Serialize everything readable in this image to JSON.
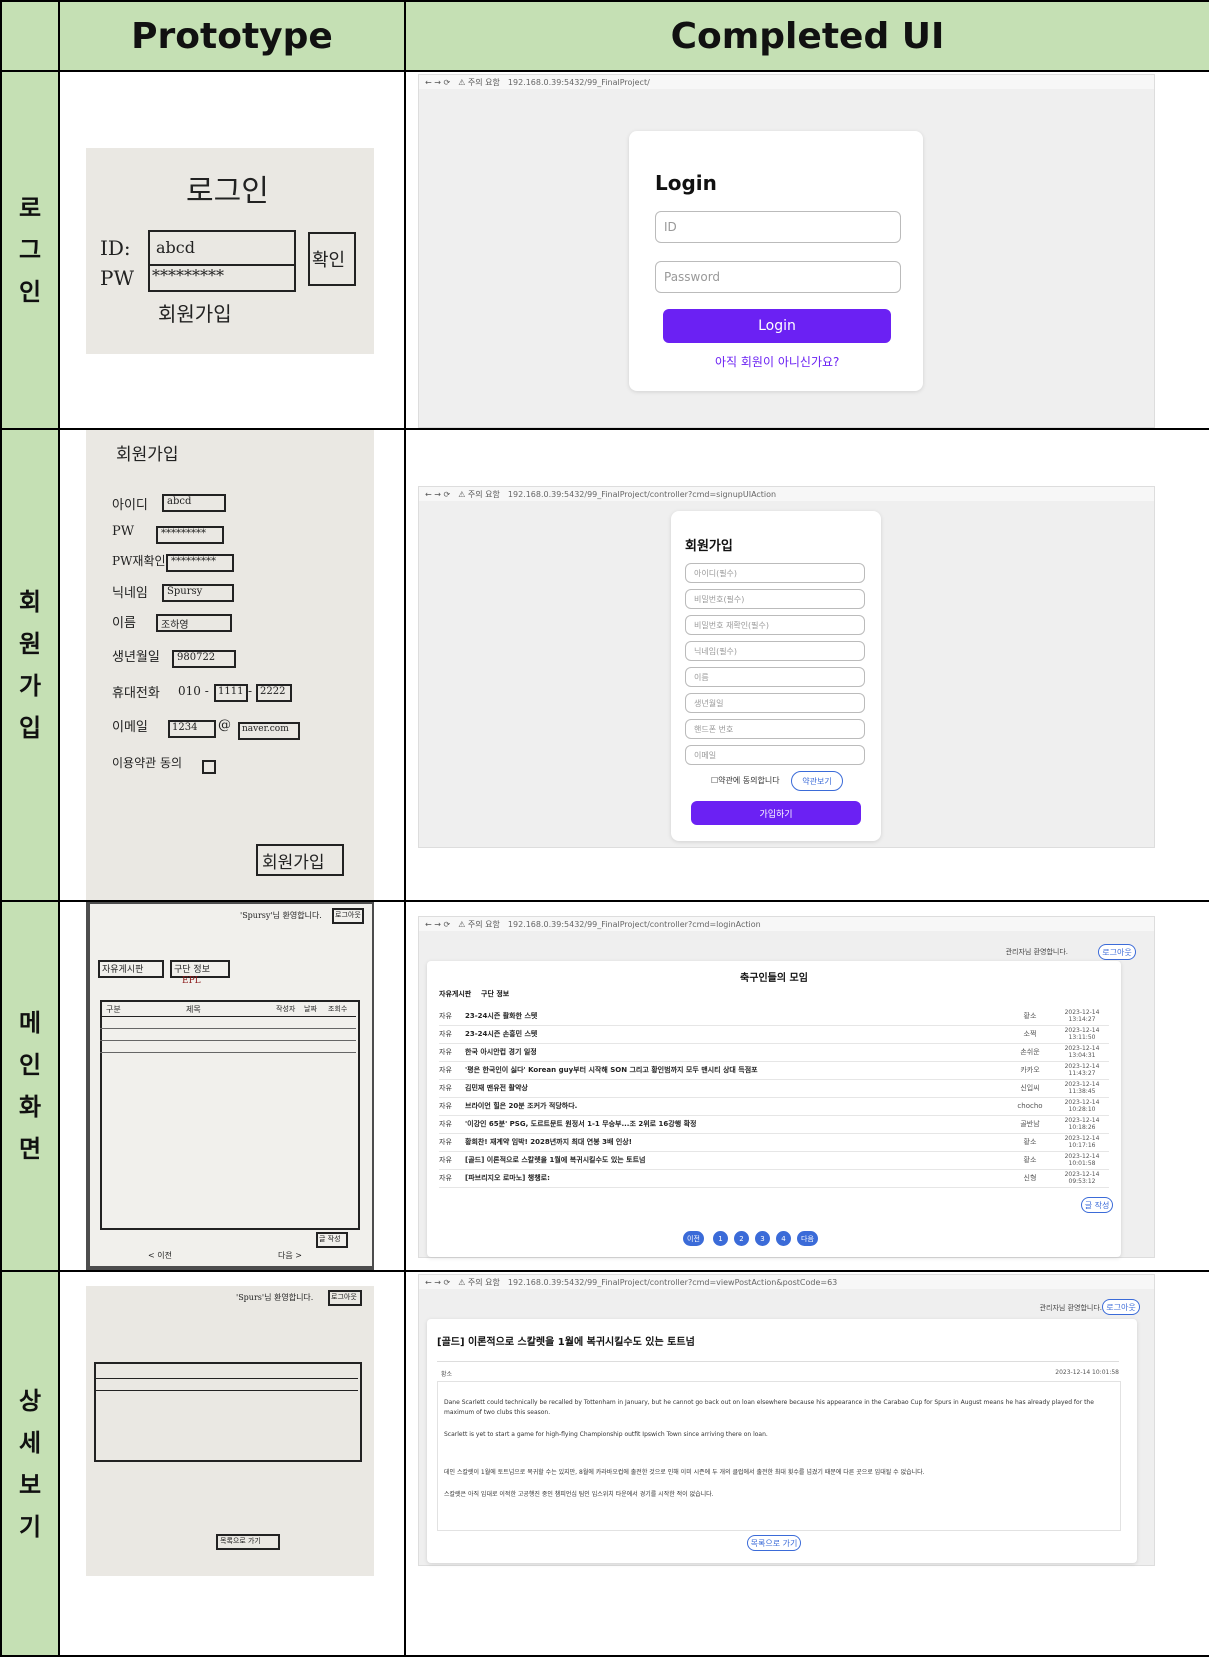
{
  "headers": {
    "prototype": "Prototype",
    "completed": "Completed UI"
  },
  "rows": {
    "login": {
      "label": [
        "로",
        "그",
        "인"
      ]
    },
    "signup": {
      "label": [
        "회",
        "원",
        "가",
        "입"
      ]
    },
    "main": {
      "label": [
        "메",
        "인",
        "화",
        "면"
      ]
    },
    "detail": {
      "label": [
        "상",
        "세",
        "보",
        "기"
      ]
    }
  },
  "proto_login": {
    "title": "로그인",
    "id_label": "ID:",
    "id_value": "abcd",
    "pw_label": "PW",
    "pw_value": "*********",
    "confirm": "확인",
    "signup": "회원가입"
  },
  "proto_signup": {
    "title": "회원가입",
    "fields": [
      {
        "label": "아이디",
        "value": "abcd"
      },
      {
        "label": "PW",
        "value": "*********"
      },
      {
        "label": "PW재확인",
        "value": "*********"
      },
      {
        "label": "닉네임",
        "value": "Spursy"
      },
      {
        "label": "이름",
        "value": "조하영"
      },
      {
        "label": "생년월일",
        "value": "980722"
      }
    ],
    "phone_label": "휴대전화",
    "phone_prefix": "010 -",
    "phone_mid": "1111",
    "phone_dash": "-",
    "phone_last": "2222",
    "email_label": "이메일",
    "email_user": "1234",
    "email_at": "@",
    "email_domain": "naver.com",
    "terms": "이용약관 동의",
    "submit": "회원가입"
  },
  "proto_main": {
    "greeting": "'Spursy'님 환영합니다.",
    "logout": "로그아웃",
    "tab_free": "자유게시판",
    "tab_club": "구단 정보",
    "tab_sub": "EPL",
    "col_type": "구분",
    "col_title": "제목",
    "col_author": "작성자",
    "col_date": "날짜",
    "col_views": "조회수",
    "write": "글 작성",
    "pager_prev": "< 이전",
    "pager_next": "다음 >"
  },
  "proto_detail": {
    "greeting": "'Spurs'님 환영합니다.",
    "logout": "로그아웃",
    "list_btn": "목록으로 가기"
  },
  "login_ui": {
    "title": "Login",
    "id_placeholder": "ID",
    "pw_placeholder": "Password",
    "button": "Login",
    "signup_link": "아직 회원이 아니신가요?"
  },
  "signup_ui": {
    "title": "회원가입",
    "fields": [
      "아이디(필수)",
      "비밀번호(필수)",
      "비밀번호 재확인(필수)",
      "닉네임(필수)",
      "이름",
      "생년월일",
      "핸드폰 번호",
      "이메일"
    ],
    "terms": "☐약관에 동의합니다",
    "terms_button": "약관보기",
    "submit": "가입하기"
  },
  "main_ui": {
    "greeting": "관리자님 환영합니다.",
    "logout": "로그아웃",
    "title": "축구인들의 모임",
    "tabs": [
      "자유게시판",
      "구단 정보"
    ],
    "posts": [
      {
        "type": "자유",
        "title": "23-24시즌 활화한 스텟",
        "author": "황소",
        "date": "2023-12-14",
        "time": "13:14:27"
      },
      {
        "type": "자유",
        "title": "23-24시즌 손흥민 스텟",
        "author": "소쩍",
        "date": "2023-12-14",
        "time": "13:11:50"
      },
      {
        "type": "자유",
        "title": "한국 아시안컵 경기 일정",
        "author": "손쉬운",
        "date": "2023-12-14",
        "time": "13:04:31"
      },
      {
        "type": "자유",
        "title": "'평은 한국인이 싫다' Korean guy부터 시작해 SON 그리고 황인범까지 모두 맨시티 상대 득점포",
        "author": "카카오",
        "date": "2023-12-14",
        "time": "11:43:27"
      },
      {
        "type": "자유",
        "title": "김민재 맨유전 활약상",
        "author": "신입씨",
        "date": "2023-12-14",
        "time": "11:38:45"
      },
      {
        "type": "자유",
        "title": "브라이언 힐은 20분 조커가 적당하다.",
        "author": "chocho",
        "date": "2023-12-14",
        "time": "10:28:10"
      },
      {
        "type": "자유",
        "title": "'이강인 65분' PSG, 도르트문트 원정서 1-1 무승부...조 2위로 16강행 확정",
        "author": "골반남",
        "date": "2023-12-14",
        "time": "10:18:26"
      },
      {
        "type": "자유",
        "title": "황희찬! 재계약 임박! 2028년까지 최대 연봉 3배 인상!",
        "author": "황소",
        "date": "2023-12-14",
        "time": "10:17:16"
      },
      {
        "type": "자유",
        "title": "[골드] 이론적으로 스칼렛을 1월에 복귀시킬수도 있는 토트넘",
        "author": "황소",
        "date": "2023-12-14",
        "time": "10:01:58"
      },
      {
        "type": "자유",
        "title": "[파브리지오 로마노] 챙챙로:",
        "author": "신형",
        "date": "2023-12-14",
        "time": "09:53:12"
      }
    ],
    "write": "글 작성",
    "pager": {
      "prev": "이전",
      "pages": [
        "1",
        "2",
        "3",
        "4"
      ],
      "next": "다음"
    }
  },
  "detail_ui": {
    "greeting": "관리자님 환영합니다.",
    "logout": "로그아웃",
    "title": "[골드] 이론적으로 스칼렛을 1월에 복귀시킬수도 있는 토트넘",
    "author": "황소",
    "datetime": "2023-12-14 10:01:58",
    "paragraphs": [
      "Dane Scarlett could technically be recalled by Tottenham in January, but he cannot go back out on loan elsewhere because his appearance in the Carabao Cup for Spurs in August means he has already played for the maximum of two clubs this season.",
      "Scarlett is yet to start a game for high-flying Championship outfit Ipswich Town since arriving there on loan.",
      "데인 스칼렛이 1월에 토트넘으로 복귀할 수는 있지만, 8월에 카라바오컵에 출전한 것으로 인해 이미 시즌에 두 개의 클럽에서 출전한 최대 횟수를 넘겼기 때문에 다른 곳으로 임대될 수 없습니다.",
      "스칼렛은 아직 임대로 이적한 고공행진 중인 챔피언십 팀인 입스위치 타운에서 경기를 시작한 적이 없습니다."
    ],
    "list_btn": "목록으로 가기"
  },
  "browser": {
    "url_login": "192.168.0.39:5432/99_FinalProject/",
    "url_signup": "192.168.0.39:5432/99_FinalProject/controller?cmd=signupUIAction",
    "url_main": "192.168.0.39:5432/99_FinalProject/controller?cmd=loginAction",
    "url_detail": "192.168.0.39:5432/99_FinalProject/controller?cmd=viewPostAction&postCode=63",
    "security": "⚠ 주의 요함"
  }
}
